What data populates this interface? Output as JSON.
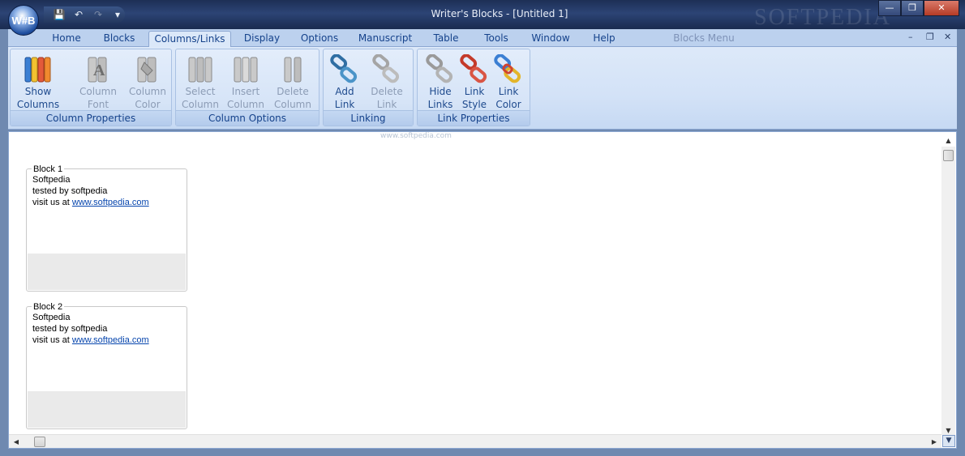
{
  "window": {
    "app_logo": "W#B",
    "title": "Writer's Blocks - [Untitled 1]",
    "watermark": "SOFTPEDIA",
    "controls": {
      "minimize": "—",
      "restore": "❐",
      "close": "✕"
    }
  },
  "quick_access": {
    "save": "💾",
    "undo": "↶",
    "redo": "↷",
    "more": "▾"
  },
  "tabs": [
    {
      "label": "Home"
    },
    {
      "label": "Blocks"
    },
    {
      "label": "Columns/Links"
    },
    {
      "label": "Display"
    },
    {
      "label": "Options"
    },
    {
      "label": "Manuscript"
    },
    {
      "label": "Table"
    },
    {
      "label": "Tools"
    },
    {
      "label": "Window"
    },
    {
      "label": "Help"
    },
    {
      "label": "Blocks Menu"
    }
  ],
  "mdi_controls": {
    "minimize": "–",
    "restore": "❐",
    "close": "✕"
  },
  "ribbon": {
    "groups": [
      {
        "caption": "Column Properties",
        "buttons": [
          {
            "line1": "Show",
            "line2": "Columns"
          },
          {
            "line1": "Column",
            "line2": "Font"
          },
          {
            "line1": "Column",
            "line2": "Color"
          }
        ]
      },
      {
        "caption": "Column Options",
        "buttons": [
          {
            "line1": "Select",
            "line2": "Column"
          },
          {
            "line1": "Insert",
            "line2": "Column"
          },
          {
            "line1": "Delete",
            "line2": "Column"
          }
        ]
      },
      {
        "caption": "Linking",
        "buttons": [
          {
            "line1": "Add",
            "line2": "Link"
          },
          {
            "line1": "Delete",
            "line2": "Link"
          }
        ]
      },
      {
        "caption": "Link Properties",
        "buttons": [
          {
            "line1": "Hide",
            "line2": "Links"
          },
          {
            "line1": "Link",
            "line2": "Style"
          },
          {
            "line1": "Link",
            "line2": "Color"
          }
        ]
      }
    ]
  },
  "document": {
    "watermark_small": "www.softpedia.com",
    "blocks": [
      {
        "title": "Block 1",
        "line1": "Softpedia",
        "line2": "tested by softpedia",
        "line3_prefix": "visit us at ",
        "link": "www.softpedia.com"
      },
      {
        "title": "Block 2",
        "line1": "Softpedia",
        "line2": "tested by softpedia",
        "line3_prefix": "visit us at ",
        "link": "www.softpedia.com"
      }
    ]
  },
  "scroll": {
    "up": "▲",
    "down": "▼",
    "left": "◀",
    "right": "▶",
    "corner": "▼"
  }
}
